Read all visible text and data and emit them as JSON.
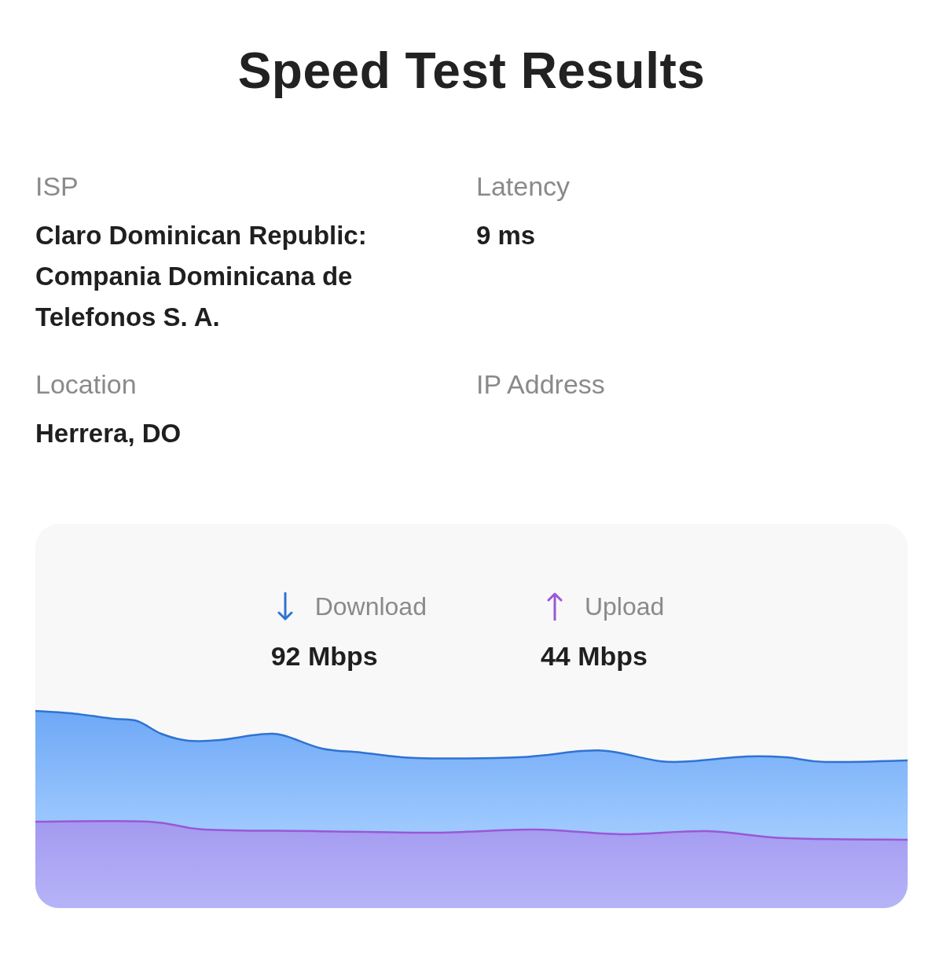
{
  "title": "Speed Test Results",
  "details": [
    {
      "label": "ISP",
      "value": "Claro Dominican Republic: Compania Dominicana de Telefonos S. A."
    },
    {
      "label": "Latency",
      "value": "9 ms"
    },
    {
      "label": "Location",
      "value": "Herrera, DO"
    },
    {
      "label": "IP Address"
    }
  ],
  "speeds": [
    {
      "kind": "download",
      "label": "Download",
      "value": "92 Mbps",
      "color": "#2f73d3"
    },
    {
      "kind": "upload",
      "label": "Upload",
      "value": "44 Mbps",
      "color": "#9a57d8"
    }
  ]
}
